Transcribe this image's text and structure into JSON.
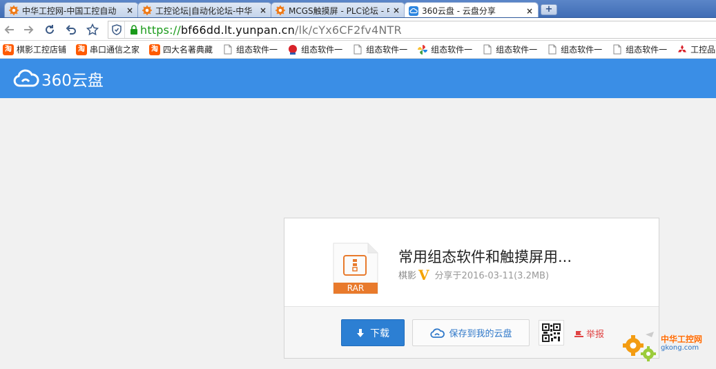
{
  "tabs": [
    {
      "title": "中华工控网-中国工控自动",
      "close": "×",
      "icon": "gear-icon"
    },
    {
      "title": "工控论坛|自动化论坛-中华",
      "close": "×",
      "icon": "gear-icon"
    },
    {
      "title": "MCGS触摸屏 - PLC论坛 - 中",
      "close": "×",
      "icon": "gear-icon"
    },
    {
      "title": "360云盘 - 云盘分享",
      "close": "×",
      "icon": "cloud-icon",
      "active": true
    }
  ],
  "newtab_label": "+",
  "address": {
    "scheme": "https://",
    "host": "bf66dd.lt.yunpan.cn",
    "path": "/lk/cYx6CF2fv4NTR"
  },
  "bookmarks": [
    {
      "label": "棋影工控店铺",
      "icon": "taobao-icon"
    },
    {
      "label": "串口通信之家",
      "icon": "taobao-icon"
    },
    {
      "label": "四大名著典藏",
      "icon": "taobao-icon"
    },
    {
      "label": "组态软件一",
      "icon": "page-icon"
    },
    {
      "label": "组态软件一",
      "icon": "red-ball-icon"
    },
    {
      "label": "组态软件一",
      "icon": "page-icon"
    },
    {
      "label": "组态软件一",
      "icon": "pinwheel-icon"
    },
    {
      "label": "组态软件一",
      "icon": "page-icon"
    },
    {
      "label": "组态软件一",
      "icon": "page-icon"
    },
    {
      "label": "组态软件一",
      "icon": "page-icon"
    },
    {
      "label": "工控品",
      "icon": "diamond-icon"
    }
  ],
  "taobao_glyph": "淘",
  "site": {
    "logo_text": "360云盘"
  },
  "file": {
    "name": "常用组态软件和触摸屏用...",
    "type_label": "RAR",
    "owner": "棋影",
    "vip": "V",
    "shared_on": "分享于2016-03-11(3.2MB)"
  },
  "actions": {
    "download": "下载",
    "save": "保存到我的云盘",
    "report": "举报"
  },
  "watermark": {
    "brand": "中华工控网",
    "domain": "gkong.com"
  },
  "colors": {
    "header_blue": "#3a8ee6",
    "download_blue": "#2c7fd3",
    "rar_orange": "#e87a2c",
    "vip_gold": "#f4a300"
  }
}
